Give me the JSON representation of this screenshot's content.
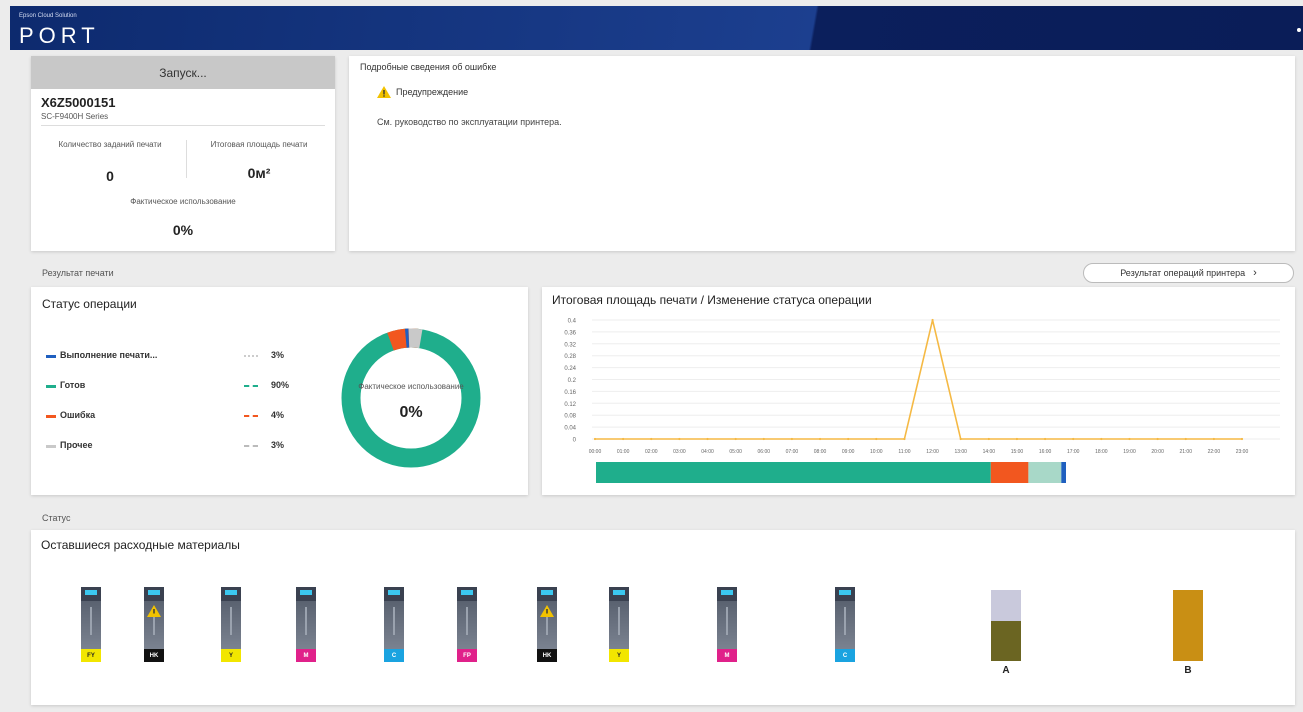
{
  "header": {
    "subtitle": "Epson Cloud Solution",
    "logo": "PORT"
  },
  "device": {
    "state": "Запуск...",
    "model": "X6Z5000151",
    "series": "SC-F9400H Series",
    "stats": [
      {
        "label": "Количество заданий печати",
        "value": "0"
      },
      {
        "label": "Итоговая площадь печати",
        "value": "0м²"
      },
      {
        "label": "Фактическое использование",
        "value": "0%"
      }
    ]
  },
  "errors": {
    "title": "Подробные сведения об ошибке",
    "warning_label": "Предупреждение",
    "message": "См. руководство по эксплуатации принтера."
  },
  "sections": {
    "print_results": "Результат печати",
    "status": "Статус"
  },
  "results_button": {
    "label": "Результат операций принтера"
  },
  "status_card": {
    "title": "Статус операции",
    "legend": [
      {
        "name": "Выполнение печати...",
        "percent": "3%",
        "color": "#1f5fbf"
      },
      {
        "name": "Готов",
        "percent": "90%",
        "color": "#1fae8c"
      },
      {
        "name": "Ошибка",
        "percent": "4%",
        "color": "#f2571f"
      },
      {
        "name": "Прочее",
        "percent": "3%",
        "color": "#c9c9c9"
      }
    ],
    "donut_label": "Фактическое использование",
    "donut_value": "0%"
  },
  "chart_data": {
    "type": "line",
    "title": "Итоговая площадь печати / Изменение статуса операции",
    "x": [
      "00:00",
      "01:00",
      "02:00",
      "03:00",
      "04:00",
      "05:00",
      "06:00",
      "07:00",
      "08:00",
      "09:00",
      "10:00",
      "11:00",
      "12:00",
      "13:00",
      "14:00",
      "15:00",
      "16:00",
      "17:00",
      "18:00",
      "19:00",
      "20:00",
      "21:00",
      "22:00",
      "23:00"
    ],
    "series": [
      {
        "values": [
          0,
          0,
          0,
          0,
          0,
          0,
          0,
          0,
          0,
          0,
          0,
          0,
          0.4,
          0,
          0,
          0,
          0,
          0,
          0,
          0,
          0,
          0,
          0,
          0
        ],
        "color": "#f5b944"
      }
    ],
    "ylim": [
      0,
      0.4
    ],
    "yticks": [
      "0",
      "0.04",
      "0.08",
      "0.12",
      "0.16",
      "0.2",
      "0.24",
      "0.28",
      "0.32",
      "0.36",
      "0.4"
    ],
    "status_bar": [
      {
        "name": "Готов",
        "value": 84,
        "color": "#1fae8c"
      },
      {
        "name": "Ошибка",
        "value": 8,
        "color": "#f2571f"
      },
      {
        "name": "Прочее",
        "value": 7,
        "color": "#a8d8c8"
      },
      {
        "name": "Выполнение печати...",
        "value": 1,
        "color": "#1f5fbf"
      }
    ]
  },
  "consumables": {
    "title": "Оставшиеся расходные материалы",
    "inks": [
      {
        "label": "FY",
        "color": "#f2e600",
        "text": "#222",
        "warning": false
      },
      {
        "label": "HK",
        "color": "#111111",
        "text": "#fff",
        "warning": true
      },
      {
        "label": "Y",
        "color": "#f2e600",
        "text": "#222",
        "warning": false
      },
      {
        "label": "M",
        "color": "#e0218a",
        "text": "#fff",
        "warning": false
      },
      {
        "label": "C",
        "color": "#1aa3e0",
        "text": "#fff",
        "warning": false
      },
      {
        "label": "FP",
        "color": "#e0218a",
        "text": "#fff",
        "warning": false
      },
      {
        "label": "HK",
        "color": "#111111",
        "text": "#fff",
        "warning": true
      },
      {
        "label": "Y",
        "color": "#f2e600",
        "text": "#222",
        "warning": false
      },
      {
        "label": "M",
        "color": "#e0218a",
        "text": "#fff",
        "warning": false
      },
      {
        "label": "C",
        "color": "#1aa3e0",
        "text": "#fff",
        "warning": false
      }
    ],
    "tanks": [
      {
        "label": "A",
        "fill_fraction": 0.57,
        "fill": "#6b6522",
        "empty": "#c9c9dc"
      },
      {
        "label": "B",
        "fill_fraction": 1.0,
        "fill": "#c98f14",
        "empty": "#c9c9dc"
      }
    ]
  }
}
